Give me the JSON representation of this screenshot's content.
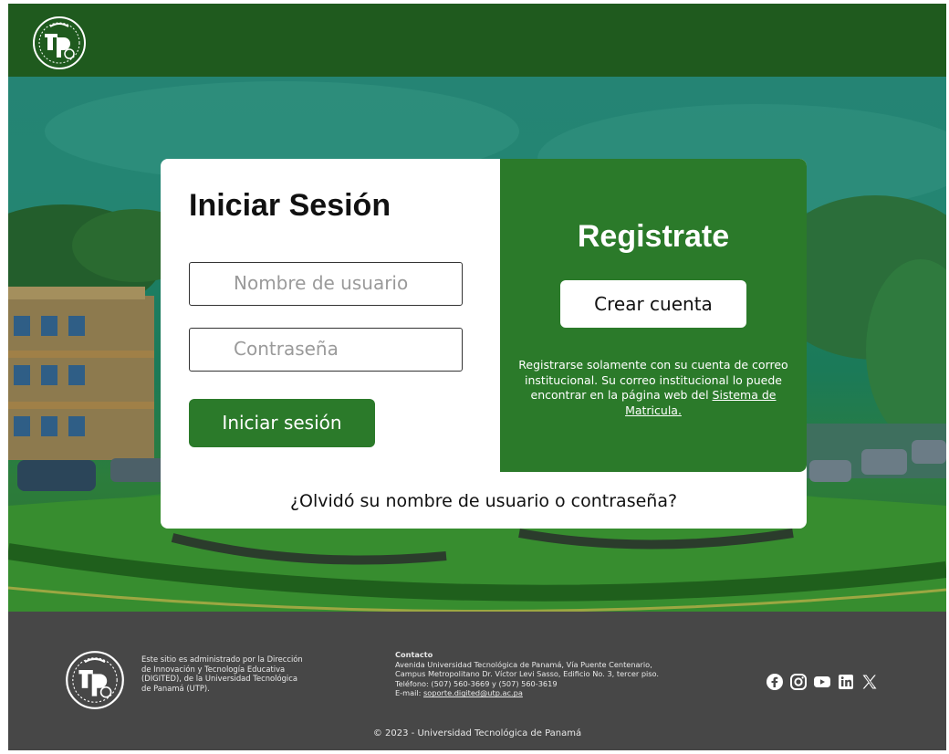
{
  "header": {
    "logo_icon": "utp-seal-logo"
  },
  "login": {
    "title": "Iniciar Sesión",
    "username_placeholder": "Nombre de usuario",
    "password_placeholder": "Contraseña",
    "submit_label": "Iniciar sesión",
    "forgot_label": "¿Olvidó su nombre de usuario o contraseña?"
  },
  "register": {
    "title": "Registrate",
    "button_label": "Crear cuenta",
    "text": "Registrarse solamente con su cuenta de correo institucional. Su correo institucional lo puede encontrar en la página web del",
    "link_label": "Sistema de Matricula."
  },
  "footer": {
    "description": "Este sitio es administrado por la Dirección de Innovación y Tecnología Educativa (DIGITED), de la Universidad Tecnológica de Panamá (UTP).",
    "contact_title": "Contacto",
    "address": "Avenida Universidad Tecnológica de Panamá, Vía Puente Centenario, Campus Metropolitano Dr. Víctor Levi Sasso, Edificio No. 3, tercer piso.",
    "phone": "Teléfono: (507) 560-3669 y (507) 560-3619",
    "email_prefix": "E-mail: ",
    "email": "soporte.digited@utp.ac.pa",
    "copyright": "© 2023 - Universidad Tecnológica de Panamá",
    "social_icons": [
      "facebook-icon",
      "instagram-icon",
      "youtube-icon",
      "linkedin-icon",
      "x-icon"
    ]
  },
  "colors": {
    "header_green": "#1f5a1e",
    "accent_green": "#2b7a2a",
    "footer_gray": "#474747"
  }
}
